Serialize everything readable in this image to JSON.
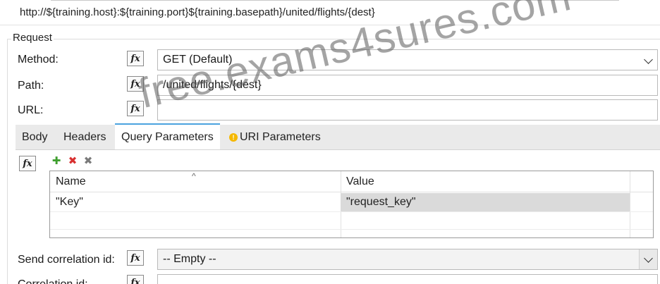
{
  "url_display": "http://${training.host}:${training.port}${training.basepath}/united/flights/{dest}",
  "request": {
    "group_label": "Request",
    "fx_label": "fx",
    "method": {
      "label": "Method:",
      "value": "GET (Default)"
    },
    "path": {
      "label": "Path:",
      "value": "/united/flights/{dest}"
    },
    "url": {
      "label": "URL:",
      "value": ""
    }
  },
  "tabs": [
    {
      "label": "Body",
      "active": false
    },
    {
      "label": "Headers",
      "active": false
    },
    {
      "label": "Query Parameters",
      "active": true
    },
    {
      "label": "URI Parameters",
      "active": false
    }
  ],
  "params_table": {
    "columns": [
      "Name",
      "Value"
    ],
    "rows": [
      {
        "name": "\"Key\"",
        "value": "\"request_key\""
      }
    ]
  },
  "correlation": {
    "send_label": "Send correlation id:",
    "send_value": "-- Empty --",
    "id_label": "Correlation id:"
  },
  "watermark": "free.exams4sures.com",
  "colors": {
    "active_tab_accent": "#4aa3df",
    "selected_cell": "#dadada",
    "warning_icon": "#f5b800"
  }
}
